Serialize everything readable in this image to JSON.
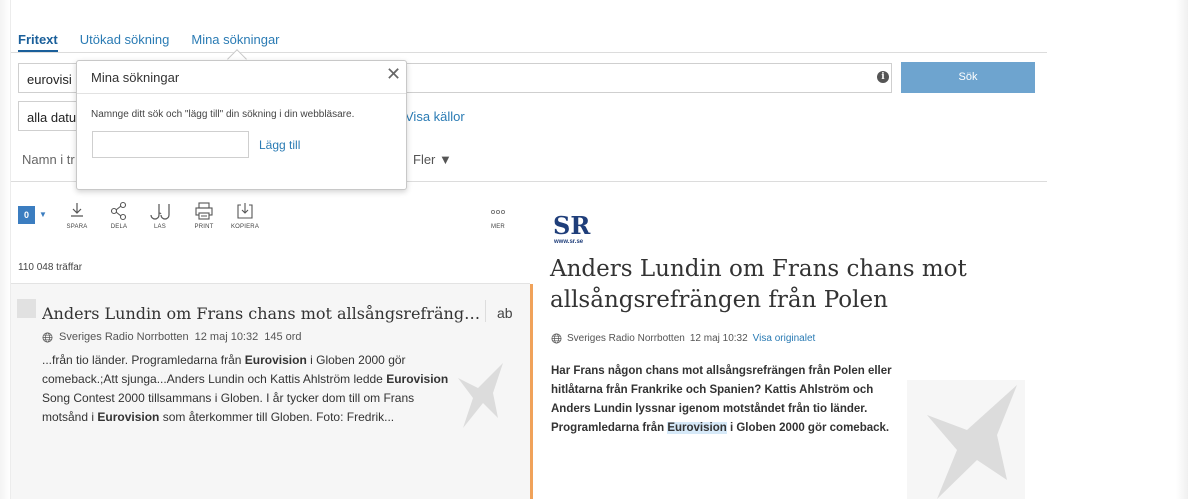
{
  "tabs": [
    {
      "label": "Fritext",
      "active": true
    },
    {
      "label": "Utökad sökning",
      "active": false
    },
    {
      "label": "Mina sökningar",
      "active": false
    }
  ],
  "search": {
    "value": "eurovisi",
    "button_label": "Sök",
    "info_icon": "info-icon"
  },
  "date_filter": {
    "value": "alla datu"
  },
  "sources_link": "Visa källor",
  "name_filter": "Namn i tr",
  "more_filters": "Fler ▼",
  "popup": {
    "title": "Mina sökningar",
    "close_icon": "close-icon",
    "hint": "Namnge ditt sök och \"lägg till\" din sökning i din webbläsare.",
    "input_value": "",
    "add_label": "Lägg till"
  },
  "toolbar": {
    "selected_count": "0",
    "actions": [
      {
        "label": "SPARA",
        "icon": "download-icon"
      },
      {
        "label": "DELA",
        "icon": "share-icon"
      },
      {
        "label": "LAS",
        "icon": "glasses-icon"
      },
      {
        "label": "PRINT",
        "icon": "print-icon"
      },
      {
        "label": "KOPIERA",
        "icon": "copy-icon"
      },
      {
        "label": "MER",
        "icon": "more-icon"
      }
    ]
  },
  "hits": "110 048 träffar",
  "result": {
    "title": "Anders Lundin om Frans chans mot allsångsrefrängen från Polen",
    "ab": "ab",
    "source": "Sveriges Radio Norrbotten",
    "date": "12 maj 10:32",
    "words": "145 ord",
    "snippet": [
      {
        "t": "...från tio länder. Programledarna från ",
        "b": false
      },
      {
        "t": "Eurovision",
        "b": true
      },
      {
        "t": " i Globen 2000 gör comeback.;Att sjunga...Anders Lundin och Kattis Ahlström ledde ",
        "b": false
      },
      {
        "t": "Eurovision",
        "b": true
      },
      {
        "t": " Song Contest 2000 tillsammans i Globen. I år tycker dom till om Frans motsånd i ",
        "b": false
      },
      {
        "t": "Eurovision",
        "b": true
      },
      {
        "t": " som återkommer till Globen. Foto: Fredrik...",
        "b": false
      }
    ]
  },
  "preview": {
    "logo_text": "SR",
    "logo_url": "www.sr.se",
    "title": "Anders Lundin om Frans chans mot allsångsrefrängen från Polen",
    "source": "Sveriges Radio Norrbotten",
    "date": "12 maj 10:32",
    "original_link": "Visa originalet",
    "body_before": "Har Frans någon chans mot allsångsrefrängen från Polen eller hitlåtarna från Frankrike och Spanien? Kattis Ahlström och Anders Lundin lyssnar igenom motståndet från tio länder. Programledarna från ",
    "body_highlight": "Eurovision",
    "body_after": " i Globen 2000 gör comeback."
  },
  "colors": {
    "accent": "#2a7bb4",
    "button": "#6ea4cf",
    "result_bar": "#f0a25a"
  }
}
